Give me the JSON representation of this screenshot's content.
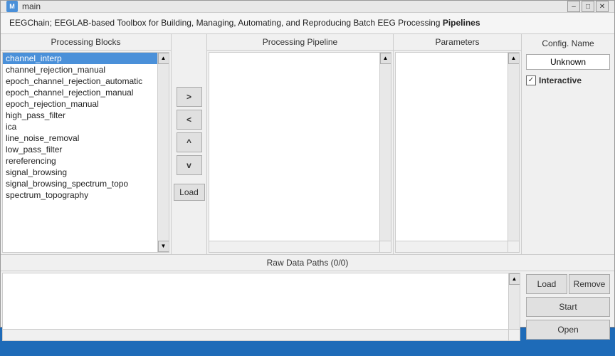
{
  "window": {
    "title": "main",
    "icon": "M"
  },
  "app_header": {
    "text_prefix": "EEGChain; EEGLAB-based Toolbox for Building, Managing, Automating, and Reproducing Batch EEG Processing ",
    "text_bold": "Pipelines"
  },
  "processing_blocks": {
    "header": "Processing Blocks",
    "items": [
      "channel_interp",
      "channel_rejection_manual",
      "epoch_channel_rejection_automatic",
      "epoch_channel_rejection_manual",
      "epoch_rejection_manual",
      "high_pass_filter",
      "ica",
      "line_noise_removal",
      "low_pass_filter",
      "rereferencing",
      "signal_browsing",
      "signal_browsing_spectrum_topo",
      "spectrum_topography"
    ],
    "selected_index": 0
  },
  "middle_buttons": {
    "add_label": ">",
    "remove_label": "<",
    "move_up_label": "^",
    "move_down_label": "v",
    "load_label": "Load"
  },
  "processing_pipeline": {
    "header": "Processing Pipeline"
  },
  "parameters": {
    "header": "Parameters"
  },
  "config": {
    "header": "Config. Name",
    "name_value": "Unknown",
    "interactive_label": "Interactive",
    "interactive_checked": true
  },
  "raw_data_paths": {
    "header": "Raw Data Paths (0/0)",
    "load_label": "Load",
    "remove_label": "Remove",
    "start_label": "Start",
    "open_label": "Open"
  }
}
